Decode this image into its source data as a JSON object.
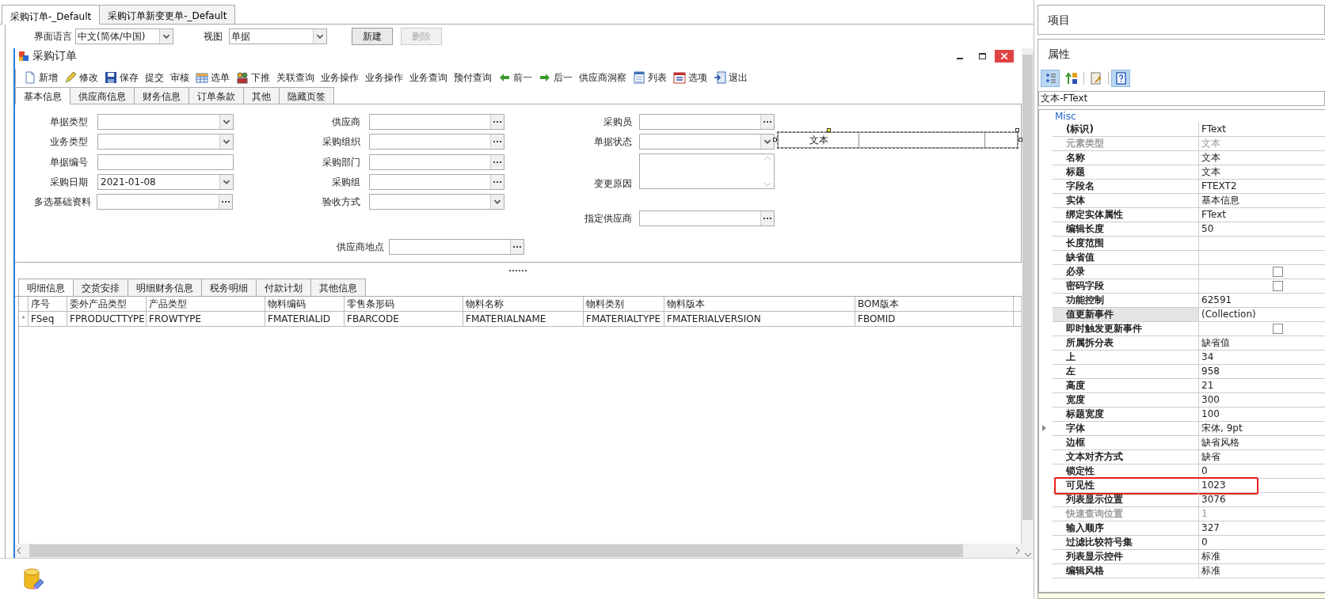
{
  "document_tabs": [
    {
      "label": "采购订单-_Default",
      "selected": true
    },
    {
      "label": "采购订单新变更单-_Default",
      "selected": false
    }
  ],
  "options_bar": {
    "language_label": "界面语言",
    "language": "中文(简体/中国)",
    "view_label": "视图",
    "view": "单据",
    "buttons": [
      {
        "label": "新建",
        "disabled": false
      },
      {
        "label": "删除",
        "disabled": true
      }
    ]
  },
  "form_window": {
    "title": "采购订单",
    "toolbar": [
      {
        "label": "新增",
        "kind": "new"
      },
      {
        "label": "修改",
        "kind": "edit"
      },
      {
        "label": "保存",
        "kind": "save"
      },
      {
        "label": "提交",
        "kind": "plain"
      },
      {
        "label": "审核",
        "kind": "plain"
      },
      {
        "label": "选单",
        "kind": "select"
      },
      {
        "label": "下推",
        "kind": "push"
      },
      {
        "label": "关联查询",
        "kind": "plain"
      },
      {
        "label": "业务操作",
        "kind": "plain"
      },
      {
        "label": "业务操作",
        "kind": "plain"
      },
      {
        "label": "业务查询",
        "kind": "plain"
      },
      {
        "label": "预付查询",
        "kind": "plain"
      },
      {
        "label": "前一",
        "kind": "prev"
      },
      {
        "label": "后一",
        "kind": "next"
      },
      {
        "label": "供应商洞察",
        "kind": "plain"
      },
      {
        "label": "列表",
        "kind": "list"
      },
      {
        "label": "选项",
        "kind": "options"
      },
      {
        "label": "退出",
        "kind": "exit"
      }
    ],
    "tabs": [
      {
        "label": "基本信息",
        "selected": true
      },
      {
        "label": "供应商信息",
        "selected": false
      },
      {
        "label": "财务信息",
        "selected": false
      },
      {
        "label": "订单条款",
        "selected": false
      },
      {
        "label": "其他",
        "selected": false
      },
      {
        "label": "隐藏页签",
        "selected": false
      }
    ],
    "fields": [
      {
        "label": "单据类型",
        "kind": "dropdown",
        "selected": false
      },
      {
        "label": "业务类型",
        "kind": "dropdown",
        "selected": false
      },
      {
        "label": "单据编号",
        "kind": "text",
        "selected": false
      },
      {
        "label": "采购日期",
        "kind": "dropdown",
        "value": "2021-01-08",
        "selected": false
      },
      {
        "label": "多选基础资料",
        "kind": "lookup",
        "selected": false
      },
      {
        "label": "供应商",
        "kind": "lookup",
        "selected": false
      },
      {
        "label": "采购组织",
        "kind": "lookup",
        "selected": false
      },
      {
        "label": "采购部门",
        "kind": "lookup",
        "selected": false
      },
      {
        "label": "采购组",
        "kind": "lookup",
        "selected": false
      },
      {
        "label": "验收方式",
        "kind": "dropdown",
        "selected": false
      },
      {
        "label": "供应商地点",
        "kind": "lookup",
        "selected": false
      },
      {
        "label": "采购员",
        "kind": "lookup",
        "selected": false
      },
      {
        "label": "单据状态",
        "kind": "dropdown",
        "selected": false
      },
      {
        "label": "变更原因",
        "kind": "textarea",
        "selected": false
      },
      {
        "label": "指定供应商",
        "kind": "lookup",
        "selected": false
      },
      {
        "label": "文本",
        "kind": "boxed_text",
        "selected": true
      }
    ],
    "detail_tabs": [
      {
        "label": "明细信息",
        "selected": true
      },
      {
        "label": "交货安排",
        "selected": false
      },
      {
        "label": "明细财务信息",
        "selected": false
      },
      {
        "label": "税务明细",
        "selected": false
      },
      {
        "label": "付款计划",
        "selected": false
      },
      {
        "label": "其他信息",
        "selected": false
      }
    ],
    "table": {
      "columns": [
        "序号",
        "委外产品类型",
        "产品类型",
        "物料编码",
        "零售条形码",
        "物料名称",
        "物料类别",
        "物料版本",
        "BOM版本"
      ],
      "rows": [
        {
          "marker": "*",
          "cells": [
            "FSeq",
            "FPRODUCTTYPE",
            "FROWTYPE",
            "FMATERIALID",
            "FBARCODE",
            "FMATERIALNAME",
            "FMATERIALTYPE",
            "FMATERIALVERSION",
            "FBOMID"
          ]
        }
      ]
    }
  },
  "side_panel": {
    "items_title": "项目",
    "properties_title": "属性",
    "toolbar": [
      {
        "kind": "categorized",
        "selected": true
      },
      {
        "kind": "alphabetical",
        "selected": false
      },
      {
        "kind": "pages",
        "selected": false
      },
      {
        "kind": "help",
        "selected": true
      }
    ],
    "object": "文本-FText",
    "category": "Misc",
    "properties": [
      {
        "name": "(标识)",
        "value": "FText",
        "kind": "text",
        "disabled": false,
        "selected": false,
        "annotated": false
      },
      {
        "name": "元素类型",
        "value": "文本",
        "kind": "text",
        "disabled": true,
        "selected": false,
        "annotated": false
      },
      {
        "name": "名称",
        "value": "文本",
        "kind": "text",
        "disabled": false,
        "selected": false,
        "annotated": false
      },
      {
        "name": "标题",
        "value": "文本",
        "kind": "text",
        "disabled": false,
        "selected": false,
        "annotated": false
      },
      {
        "name": "字段名",
        "value": "FTEXT2",
        "kind": "text",
        "disabled": false,
        "selected": false,
        "annotated": false
      },
      {
        "name": "实体",
        "value": "基本信息",
        "kind": "text",
        "disabled": false,
        "selected": false,
        "annotated": false
      },
      {
        "name": "绑定实体属性",
        "value": "FText",
        "kind": "text",
        "disabled": false,
        "selected": false,
        "annotated": false
      },
      {
        "name": "编辑长度",
        "value": "50",
        "kind": "text",
        "disabled": false,
        "selected": false,
        "annotated": false
      },
      {
        "name": "长度范围",
        "kind": "text",
        "disabled": false,
        "selected": false,
        "annotated": false
      },
      {
        "name": "缺省值",
        "kind": "text",
        "disabled": false,
        "selected": false,
        "annotated": false
      },
      {
        "name": "必录",
        "kind": "checkbox",
        "checked": false,
        "disabled": false,
        "selected": false,
        "annotated": false
      },
      {
        "name": "密码字段",
        "kind": "checkbox",
        "checked": false,
        "disabled": false,
        "selected": false,
        "annotated": false
      },
      {
        "name": "功能控制",
        "value": "62591",
        "kind": "text",
        "disabled": false,
        "selected": false,
        "annotated": false
      },
      {
        "name": "值更新事件",
        "value": "(Collection)",
        "kind": "text",
        "disabled": false,
        "selected": true,
        "annotated": false
      },
      {
        "name": "即时触发更新事件",
        "kind": "checkbox",
        "checked": false,
        "disabled": false,
        "selected": false,
        "annotated": false
      },
      {
        "name": "所属拆分表",
        "value": "缺省值",
        "kind": "text",
        "disabled": false,
        "selected": false,
        "annotated": false
      },
      {
        "name": "上",
        "value": "34",
        "kind": "text",
        "disabled": false,
        "selected": false,
        "annotated": false
      },
      {
        "name": "左",
        "value": "958",
        "kind": "text",
        "disabled": false,
        "selected": false,
        "annotated": false
      },
      {
        "name": "高度",
        "value": "21",
        "kind": "text",
        "disabled": false,
        "selected": false,
        "annotated": false
      },
      {
        "name": "宽度",
        "value": "300",
        "kind": "text",
        "disabled": false,
        "selected": false,
        "annotated": false
      },
      {
        "name": "标题宽度",
        "value": "100",
        "kind": "text",
        "disabled": false,
        "selected": false,
        "annotated": false
      },
      {
        "name": "字体",
        "value": "宋体, 9pt",
        "kind": "group",
        "expanded": false,
        "disabled": false,
        "selected": false,
        "annotated": false
      },
      {
        "name": "边框",
        "value": "缺省风格",
        "kind": "text",
        "disabled": false,
        "selected": false,
        "annotated": false
      },
      {
        "name": "文本对齐方式",
        "value": "缺省",
        "kind": "text",
        "disabled": false,
        "selected": false,
        "annotated": false
      },
      {
        "name": "锁定性",
        "value": "0",
        "kind": "text",
        "disabled": false,
        "selected": false,
        "annotated": false
      },
      {
        "name": "可见性",
        "value": "1023",
        "kind": "text",
        "disabled": false,
        "selected": false,
        "annotated": true
      },
      {
        "name": "列表显示位置",
        "value": "3076",
        "kind": "text",
        "disabled": false,
        "selected": false,
        "annotated": false
      },
      {
        "name": "快速查询位置",
        "value": "1",
        "kind": "text",
        "disabled": true,
        "selected": false,
        "annotated": false
      },
      {
        "name": "输入顺序",
        "value": "327",
        "kind": "text",
        "disabled": false,
        "selected": false,
        "annotated": false
      },
      {
        "name": "过滤比较符号集",
        "value": "0",
        "kind": "text",
        "disabled": false,
        "selected": false,
        "annotated": false
      },
      {
        "name": "列表显示控件",
        "value": "标准",
        "kind": "text",
        "disabled": false,
        "selected": false,
        "annotated": false
      },
      {
        "name": "编辑风格",
        "value": "标准",
        "kind": "text",
        "disabled": false,
        "selected": false,
        "annotated": false
      }
    ]
  }
}
